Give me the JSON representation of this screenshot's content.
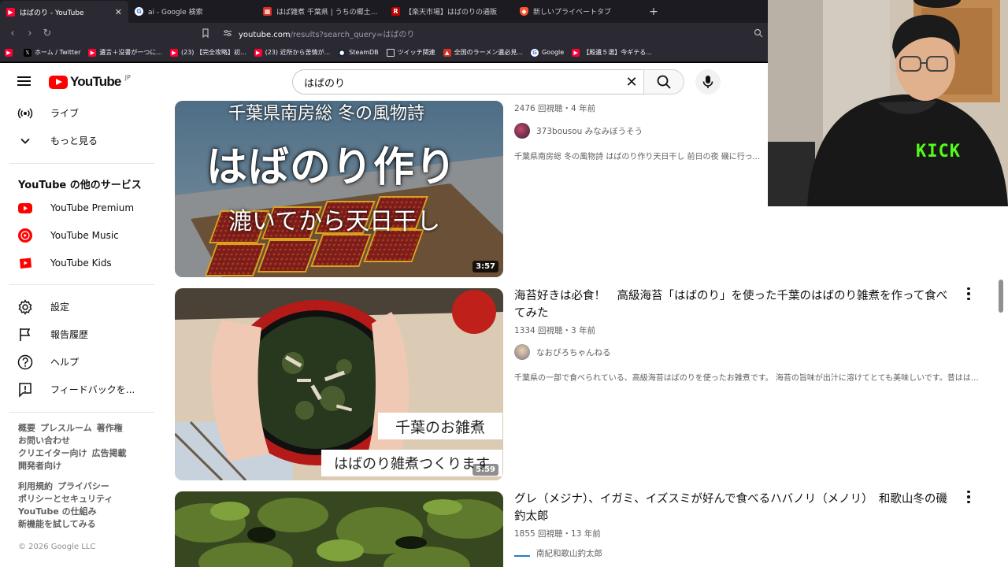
{
  "browser": {
    "tabs": [
      {
        "title": "はばのり - YouTube",
        "active": true,
        "favicon_color": "#ff0033",
        "favicon": "youtube-icon"
      },
      {
        "title": "ai - Google 検索",
        "active": false,
        "favicon_color": "#4285f4",
        "favicon": "google-icon"
      },
      {
        "title": "はば雑煮 千葉県 | うちの郷土料理：農",
        "active": false,
        "favicon_color": "#d93025",
        "favicon": "maff-icon"
      },
      {
        "title": "【楽天市場】はばのりの通販",
        "active": false,
        "favicon_color": "#bf0000",
        "favicon": "rakuten-icon"
      },
      {
        "title": "新しいプライベートタブ",
        "active": false,
        "favicon_color": "#fb542b",
        "favicon": "brave-icon"
      }
    ],
    "new_tab": "+",
    "url_host": "youtube.com",
    "url_path": "/results?search_query=はばのり",
    "bookmarks": [
      {
        "label": "",
        "color": "#ff0033"
      },
      {
        "label": "ホーム / Twitter",
        "color": "#000000"
      },
      {
        "label": "遺言＋没書が一つに...",
        "color": "#ff0033"
      },
      {
        "label": "(23) 【完全攻略】初...",
        "color": "#ff0033"
      },
      {
        "label": "(23) 近所から苦情が...",
        "color": "#ff0033"
      },
      {
        "label": "SteamDB",
        "color": "#1b2838"
      },
      {
        "label": "ツイッチ関連",
        "color": "#9146ff"
      },
      {
        "label": "全国のラーメン遺必見...",
        "color": "#d93025"
      },
      {
        "label": "Google",
        "color": "#4285f4"
      },
      {
        "label": "【殿遺５選】今ギテる...",
        "color": "#ff0033"
      }
    ]
  },
  "masthead": {
    "logo_text": "YouTube",
    "region": "JP",
    "search_query": "はばのり"
  },
  "sidebar": {
    "top_items": [
      {
        "label": "ライブ",
        "icon": "live-icon"
      },
      {
        "label": "もっと見る",
        "icon": "chevron-down-icon"
      }
    ],
    "services_heading": "YouTube の他のサービス",
    "services": [
      {
        "label": "YouTube Premium",
        "icon": "youtube-premium-icon"
      },
      {
        "label": "YouTube Music",
        "icon": "youtube-music-icon"
      },
      {
        "label": "YouTube Kids",
        "icon": "youtube-kids-icon"
      }
    ],
    "settings_items": [
      {
        "label": "設定",
        "icon": "gear-icon"
      },
      {
        "label": "報告履歴",
        "icon": "flag-icon"
      },
      {
        "label": "ヘルプ",
        "icon": "help-icon"
      },
      {
        "label": "フィードバックを...",
        "icon": "feedback-icon"
      }
    ],
    "footer_links_1": [
      "概要",
      "プレスルーム",
      "著作権",
      "お問い合わせ",
      "クリエイター向け",
      "広告掲載",
      "開発者向け"
    ],
    "footer_links_2": [
      "利用規約",
      "プライバシー",
      "ポリシーとセキュリティ",
      "YouTube の仕組み",
      "新機能を試してみる"
    ],
    "copyright": "© 2026 Google LLC"
  },
  "results": [
    {
      "thumb_text_1": "千葉県南房総 冬の風物詩",
      "thumb_text_2": "はばのり作り",
      "thumb_text_3": "漉いてから天日干し",
      "duration": "3:57",
      "title": "",
      "meta": "2476 回視聴・4 年前",
      "channel": "373bousou みなみぼうそう",
      "description": "千葉県南房総 冬の風物詩 はばのり作り天日干し 前日の夜 磯に行って採"
    },
    {
      "thumb_text_1": "千葉のお雑煮",
      "thumb_text_2": "はばのり雑煮つくります",
      "duration": "5:59",
      "title": "海苔好きは必食！　高級海苔「はばのり」を使った千葉のはばのり雑煮を作って食べてみた",
      "meta": "1334 回視聴・3 年前",
      "channel": "なおぴろちゃんねる",
      "description": "千葉県の一部で食べられている、高級海苔はばのりを使ったお雑煮です。 海苔の旨味が出汁に溶けてとても美味しいです。昔はは ..."
    },
    {
      "title": "グレ（メジナ）、イガミ、イズスミが好んで食べるハバノリ（メノリ）　和歌山冬の磯　釣太郎",
      "meta": "1855 回視聴・13 年前",
      "channel": "南紀和歌山釣太郎"
    }
  ],
  "webcam": {
    "shirt_text": "KICK"
  }
}
